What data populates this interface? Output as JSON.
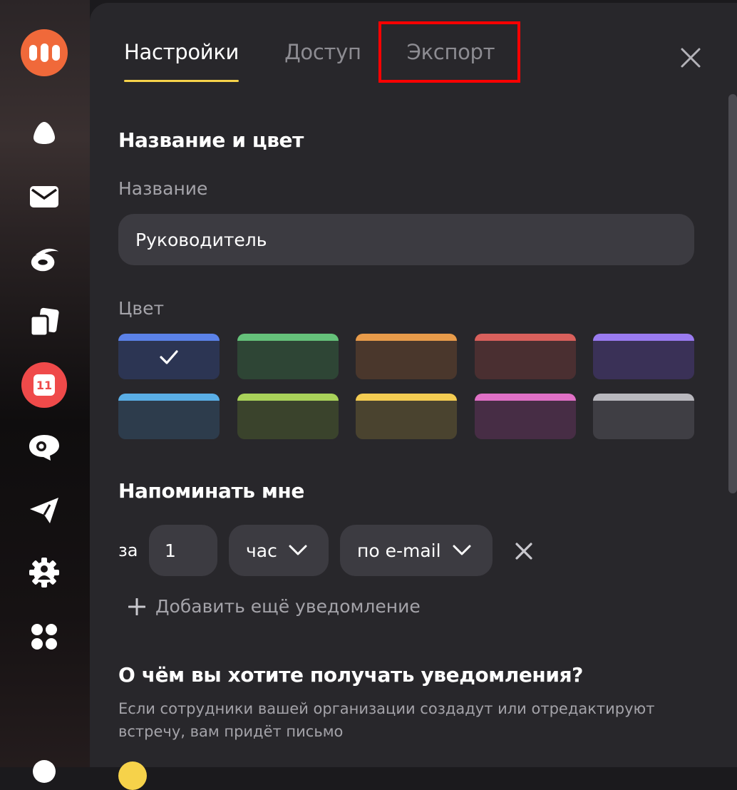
{
  "sidebar": {
    "calendar_day": "11"
  },
  "tabs": [
    {
      "label": "Настройки"
    },
    {
      "label": "Доступ"
    },
    {
      "label": "Экспорт"
    }
  ],
  "settings": {
    "name_color_heading": "Название и цвет",
    "name_label": "Название",
    "name_value": "Руководитель",
    "color_label": "Цвет",
    "colors": [
      {
        "bar": "#5b82e8",
        "fill": "#2c3553"
      },
      {
        "bar": "#65c17a",
        "fill": "#2e4535"
      },
      {
        "bar": "#e89b4a",
        "fill": "#4a372c"
      },
      {
        "bar": "#d9605c",
        "fill": "#4a2f31"
      },
      {
        "bar": "#9a7bf0",
        "fill": "#3a3157"
      },
      {
        "bar": "#5aaee6",
        "fill": "#2d3c4c"
      },
      {
        "bar": "#a9d25a",
        "fill": "#3a432c"
      },
      {
        "bar": "#f4cc52",
        "fill": "#4a432f"
      },
      {
        "bar": "#e070c6",
        "fill": "#472d45"
      },
      {
        "bar": "#b9b8be",
        "fill": "#3f3e44"
      }
    ],
    "selected_color_index": 0,
    "remind_heading": "Напоминать мне",
    "remind_prefix": "за",
    "remind_amount": "1",
    "remind_unit": "час",
    "remind_channel": "по e-mail",
    "add_notification": "Добавить ещё уведомление",
    "notify_heading": "О чём вы хотите получать уведомления?",
    "notify_description": "Если сотрудники вашей организации создадут или отредактируют встречу, вам придёт письмо"
  }
}
